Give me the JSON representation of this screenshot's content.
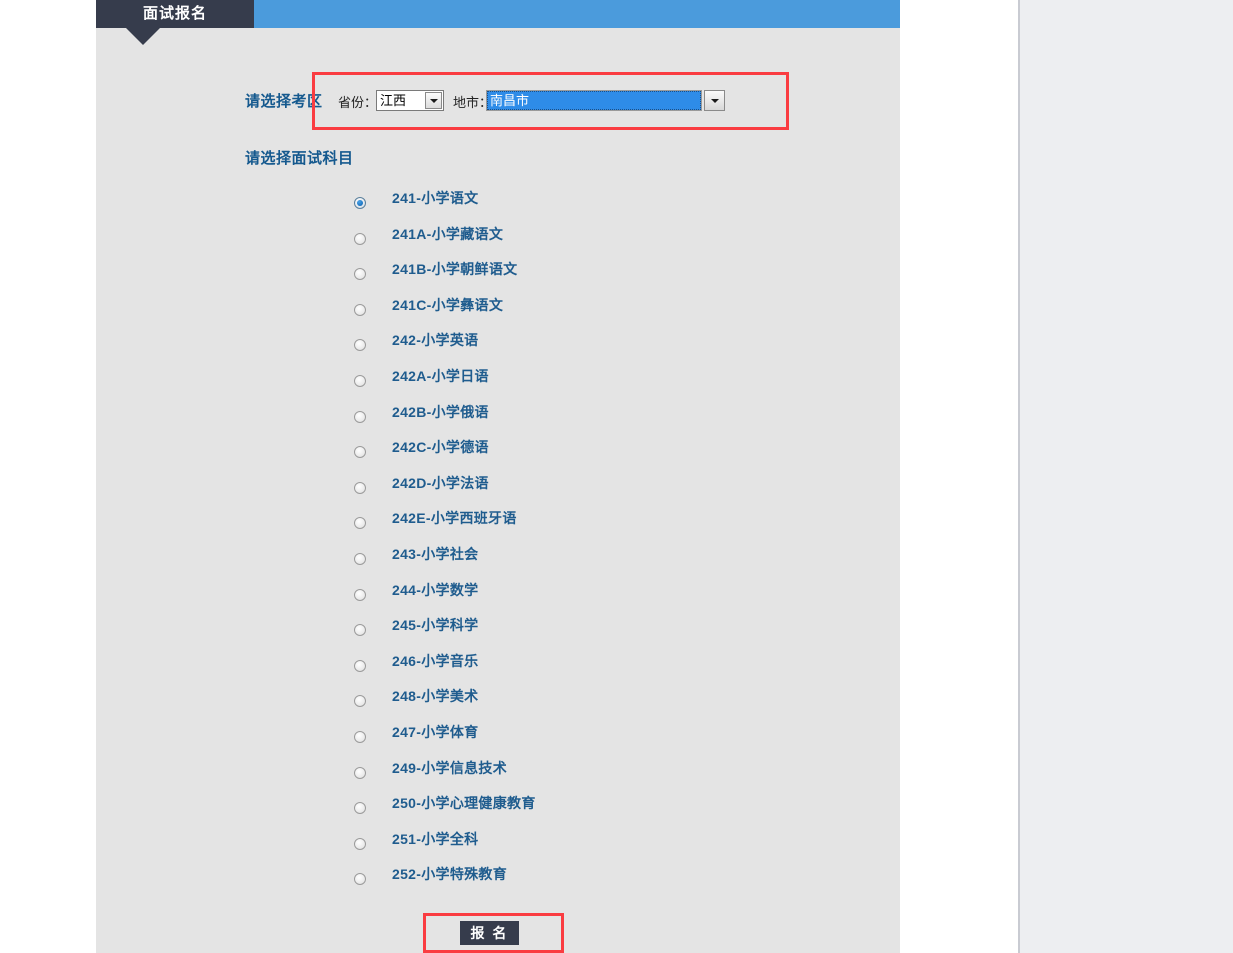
{
  "header": {
    "active_tab": "面试报名",
    "tab_bg": "#363c4c",
    "bar_bg": "#4b9bdc"
  },
  "exam_area": {
    "section_label": "请选择考区",
    "province_label": "省份：",
    "province_value": "江西",
    "city_label": "地市：",
    "city_value": "南昌市",
    "highlight_color": "#fa3c41"
  },
  "subjects": {
    "section_label": "请选择面试科目",
    "selected_index": 0,
    "items": [
      {
        "label": "241-小学语文"
      },
      {
        "label": "241A-小学藏语文"
      },
      {
        "label": "241B-小学朝鲜语文"
      },
      {
        "label": "241C-小学彝语文"
      },
      {
        "label": "242-小学英语"
      },
      {
        "label": "242A-小学日语"
      },
      {
        "label": "242B-小学俄语"
      },
      {
        "label": "242C-小学德语"
      },
      {
        "label": "242D-小学法语"
      },
      {
        "label": "242E-小学西班牙语"
      },
      {
        "label": "243-小学社会"
      },
      {
        "label": "244-小学数学"
      },
      {
        "label": "245-小学科学"
      },
      {
        "label": "246-小学音乐"
      },
      {
        "label": "248-小学美术"
      },
      {
        "label": "247-小学体育"
      },
      {
        "label": "249-小学信息技术"
      },
      {
        "label": "250-小学心理健康教育"
      },
      {
        "label": "251-小学全科"
      },
      {
        "label": "252-小学特殊教育"
      }
    ]
  },
  "submit": {
    "label": "报 名"
  }
}
